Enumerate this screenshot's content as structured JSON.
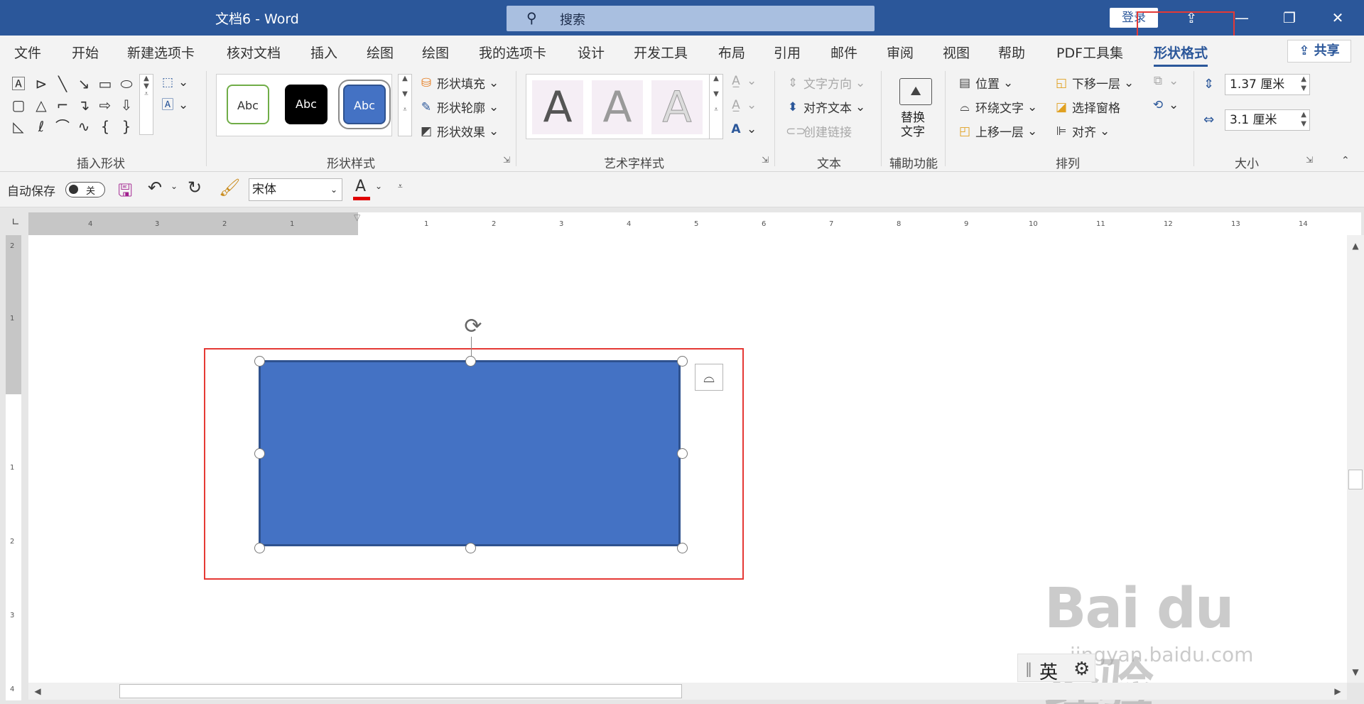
{
  "titlebar": {
    "document_title": "文档6  -  Word",
    "search_placeholder": "搜索",
    "login_label": "登录",
    "icons": [
      "search-icon",
      "upload-icon",
      "minimize-icon",
      "restore-icon",
      "close-icon"
    ]
  },
  "tabs": [
    "文件",
    "开始",
    "新建选项卡",
    "核对文档",
    "插入",
    "绘图",
    "绘图",
    "我的选项卡",
    "设计",
    "开发工具",
    "布局",
    "引用",
    "邮件",
    "审阅",
    "视图",
    "帮助",
    "PDF工具集",
    "形状格式"
  ],
  "active_tab": "形状格式",
  "share_label": "共享",
  "ribbon": {
    "insert_shapes": {
      "label": "插入形状"
    },
    "shape_styles": {
      "label": "形状样式",
      "gallery": [
        "Abc",
        "Abc",
        "Abc"
      ],
      "fill": "形状填充",
      "outline": "形状轮廓",
      "effects": "形状效果"
    },
    "wordart": {
      "label": "艺术字样式",
      "letters": [
        "A",
        "A",
        "A"
      ]
    },
    "text": {
      "label": "文本",
      "direction": "文字方向",
      "align": "对齐文本",
      "link": "创建链接"
    },
    "accessibility": {
      "label": "辅助功能",
      "alt_text_line1": "替换",
      "alt_text_line2": "文字"
    },
    "arrange": {
      "label": "排列",
      "position": "位置",
      "wrap": "环绕文字",
      "bring_forward": "上移一层",
      "send_backward": "下移一层",
      "selection_pane": "选择窗格",
      "align": "对齐"
    },
    "size": {
      "label": "大小",
      "height": "1.37 厘米",
      "width": "3.1 厘米"
    }
  },
  "qat": {
    "autosave_label": "自动保存",
    "autosave_state": "关",
    "font_name": "宋体"
  },
  "ruler": {
    "h_left": [
      "4",
      "3",
      "2",
      "1"
    ],
    "h_right": [
      "1",
      "2",
      "3",
      "4",
      "5",
      "6",
      "7",
      "8",
      "9",
      "10",
      "11",
      "12",
      "13",
      "14"
    ],
    "v": [
      "2",
      "1",
      "1",
      "2",
      "3",
      "4"
    ]
  },
  "colors": {
    "title_bar": "#2b579a",
    "shape_fill": "#4472c4",
    "shape_border": "#2f528f",
    "highlight": "#e53935",
    "font_color_bar": "#e00000"
  },
  "ime": {
    "lang": "英"
  },
  "watermark": {
    "brand": "Bai du 经验",
    "url": "jingyan.baidu.com"
  }
}
